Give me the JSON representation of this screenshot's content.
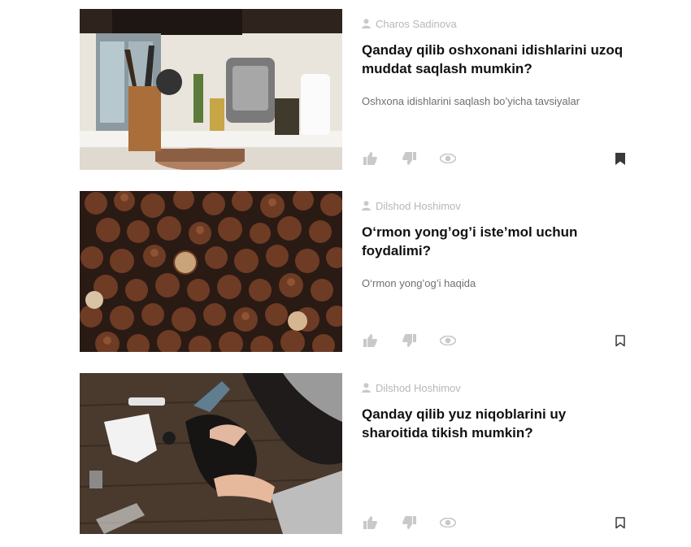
{
  "colors": {
    "icon_grey": "#c9c9c9",
    "bookmark_dark": "#3a3a3a",
    "title": "#111111",
    "author": "#b7b7b7",
    "excerpt": "#6f6f6f"
  },
  "articles": [
    {
      "author": "Charos Sadinova",
      "title": "Qanday qilib oshxonani idishlarini uzoq muddat saqlash mumkin?",
      "excerpt": "Oshxona idishlarini saqlash bo’yicha tavsiyalar",
      "image_icon": "kitchen-photo",
      "bookmarked": true
    },
    {
      "author": "Dilshod Hoshimov",
      "title": "O‘rmon yong’og’i iste’mol uchun foydalimi?",
      "excerpt": "O‘rmon yong’og’i haqida",
      "image_icon": "hazelnuts-photo",
      "bookmarked": false
    },
    {
      "author": "Dilshod Hoshimov",
      "title": "Qanday qilib yuz niqoblarini uy sharoitida tikish mumkin?",
      "excerpt": "",
      "image_icon": "sewing-mask-photo",
      "bookmarked": false
    }
  ]
}
